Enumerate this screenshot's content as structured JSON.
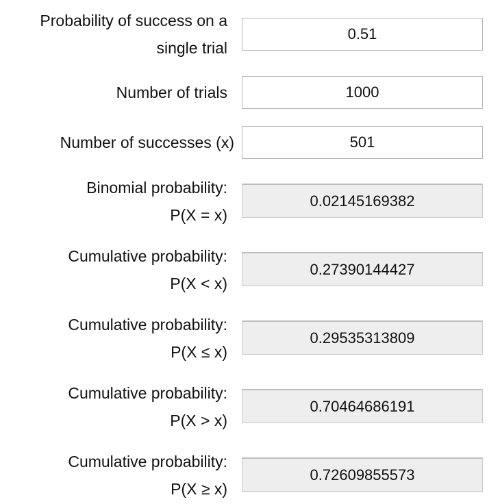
{
  "inputs": {
    "probability": {
      "label_line1": "Probability of success on a",
      "label_line2": "single trial",
      "value": "0.51"
    },
    "trials": {
      "label": "Number of trials",
      "value": "1000"
    },
    "successes": {
      "label": "Number of successes (x)",
      "value": "501"
    }
  },
  "results": [
    {
      "label_line1": "Binomial probability:",
      "label_line2": "P(X = x)",
      "value": "0.02145169382"
    },
    {
      "label_line1": "Cumulative probability:",
      "label_line2": "P(X < x)",
      "value": "0.27390144427"
    },
    {
      "label_line1": "Cumulative probability:",
      "label_line2": "P(X ≤ x)",
      "value": "0.29535313809"
    },
    {
      "label_line1": "Cumulative probability:",
      "label_line2": "P(X > x)",
      "value": "0.70464686191"
    },
    {
      "label_line1": "Cumulative probability:",
      "label_line2": "P(X ≥ x)",
      "value": "0.72609855573"
    }
  ]
}
